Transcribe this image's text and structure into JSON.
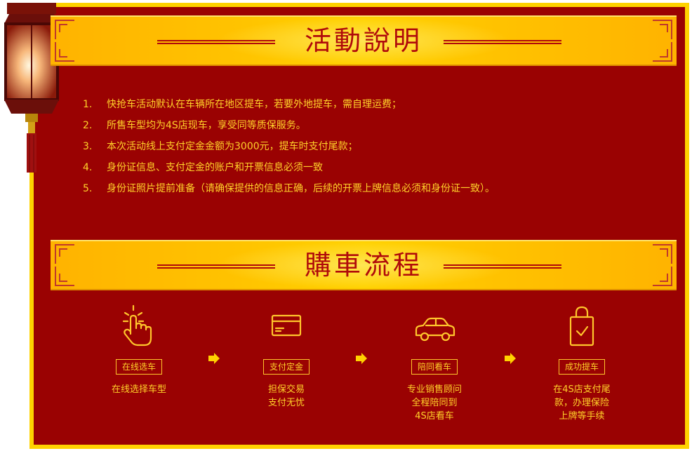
{
  "activity": {
    "title": "活動說明",
    "rules": [
      {
        "num": "1.",
        "text": "快抢车活动默认在车辆所在地区提车，若要外地提车，需自理运费；"
      },
      {
        "num": "2.",
        "text": "所售车型均为4S店现车，享受同等质保服务。"
      },
      {
        "num": "3.",
        "text": "本次活动线上支付定金金额为3000元，提车时支付尾款；"
      },
      {
        "num": "4.",
        "text": "身份证信息、支付定金的账户和开票信息必须一致"
      },
      {
        "num": "5.",
        "text": "身份证照片提前准备（请确保提供的信息正确，后续的开票上牌信息必须和身份证一致）。"
      }
    ]
  },
  "process": {
    "title": "購車流程",
    "steps": [
      {
        "icon": "tap-hand-icon",
        "tag": "在线选车",
        "desc": [
          "在线选择车型"
        ]
      },
      {
        "icon": "credit-card-icon",
        "tag": "支付定金",
        "desc": [
          "担保交易",
          "支付无忧"
        ]
      },
      {
        "icon": "car-icon",
        "tag": "陪同看车",
        "desc": [
          "专业销售顾问",
          "全程陪同到",
          "4S店看车"
        ]
      },
      {
        "icon": "shopping-bag-icon",
        "tag": "成功提车",
        "desc": [
          "在4S店支付尾",
          "款，办理保险",
          "上牌等手续"
        ]
      }
    ]
  },
  "colors": {
    "background": "#9A0202",
    "border": "#FFD200",
    "text": "#FFD22A",
    "title": "#B00A0A"
  }
}
